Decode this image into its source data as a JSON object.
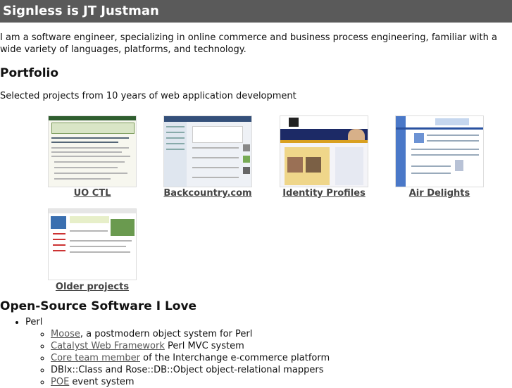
{
  "header": {
    "title": "Signless is JT Justman"
  },
  "intro": "I am a software engineer, specializing in online commerce and business process engineering, familiar with a wide variety of languages, platforms, and technology.",
  "portfolio": {
    "heading": "Portfolio",
    "subtitle": "Selected projects from 10 years of web application development",
    "projects": [
      {
        "label": "UO CTL"
      },
      {
        "label": "Backcountry.com"
      },
      {
        "label": "Identity Profiles"
      },
      {
        "label": "Air Delights"
      },
      {
        "label": "Older projects"
      }
    ]
  },
  "oss": {
    "heading": "Open-Source Software I Love",
    "categories": [
      {
        "name": "Perl",
        "items": [
          {
            "link": "Moose",
            "text": ", a postmodern object system for Perl"
          },
          {
            "link": "Catalyst Web Framework",
            "text": " Perl MVC system"
          },
          {
            "link": "Core team member",
            "text": " of the Interchange e-commerce platform"
          },
          {
            "link": "",
            "text": "DBIx::Class and Rose::DB::Object object-relational mappers"
          },
          {
            "link": "POE",
            "text": " event system"
          }
        ]
      }
    ]
  }
}
